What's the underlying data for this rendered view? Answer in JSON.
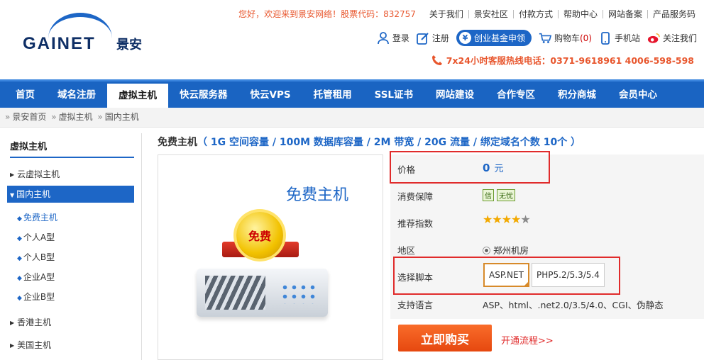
{
  "logo": {
    "text": "GAINET",
    "cn": "景安"
  },
  "top_nav": {
    "welcome": "您好，欢迎来到景安网络！股票代码：832757",
    "links": [
      "关于我们",
      "景安社区",
      "付款方式",
      "帮助中心",
      "网站备案",
      "产品服务码"
    ]
  },
  "toolbar": {
    "login": "登录",
    "register": "注册",
    "fund": "创业基金申领",
    "cart": "购物车",
    "cart_count": "(0)",
    "mobile": "手机站",
    "follow": "关注我们"
  },
  "hotline": "7x24小时客服热线电话：0371-9618961  4006-598-598",
  "main_nav": [
    "首页",
    "域名注册",
    "虚拟主机",
    "快云服务器",
    "快云VPS",
    "托管租用",
    "SSL证书",
    "网站建设",
    "合作专区",
    "积分商城",
    "会员中心"
  ],
  "main_nav_active": "虚拟主机",
  "breadcrumb": [
    "景安首页",
    "虚拟主机",
    "国内主机"
  ],
  "sidebar": {
    "title": "虚拟主机",
    "items": [
      "云虚拟主机",
      "国内主机",
      "香港主机",
      "美国主机"
    ],
    "sub_items": [
      "免费主机",
      "个人A型",
      "个人B型",
      "企业A型",
      "企业B型"
    ]
  },
  "product": {
    "name": "免费主机",
    "specs": "（ 1G 空间容量 / 100M 数据库容量 / 2M 带宽 / 20G 流量 / 绑定域名个数 10个 ）",
    "image_label": "免费主机",
    "medal_text": "免费"
  },
  "details": {
    "price_label": "价格",
    "price_value": "0",
    "price_unit": "元",
    "guarantee_label": "消费保障",
    "guarantee_badges": [
      "信",
      "无忧"
    ],
    "rating_label": "推荐指数",
    "rating": 4,
    "rating_max": 5,
    "region_label": "地区",
    "region_value": "郑州机房",
    "script_label": "选择脚本",
    "script_options": [
      "ASP.NET",
      "PHP5.2/5.3/5.4"
    ],
    "script_selected": "ASP.NET",
    "lang_label": "支持语言",
    "lang_value": "ASP、html、.net2.0/3.5/4.0、CGI、伪静态"
  },
  "buy_button": "立即购买",
  "flow_link": "开通流程>>",
  "colors": {
    "accent": "#1d66c6",
    "orange": "#e8562d",
    "highlight": "#e02b2b"
  }
}
